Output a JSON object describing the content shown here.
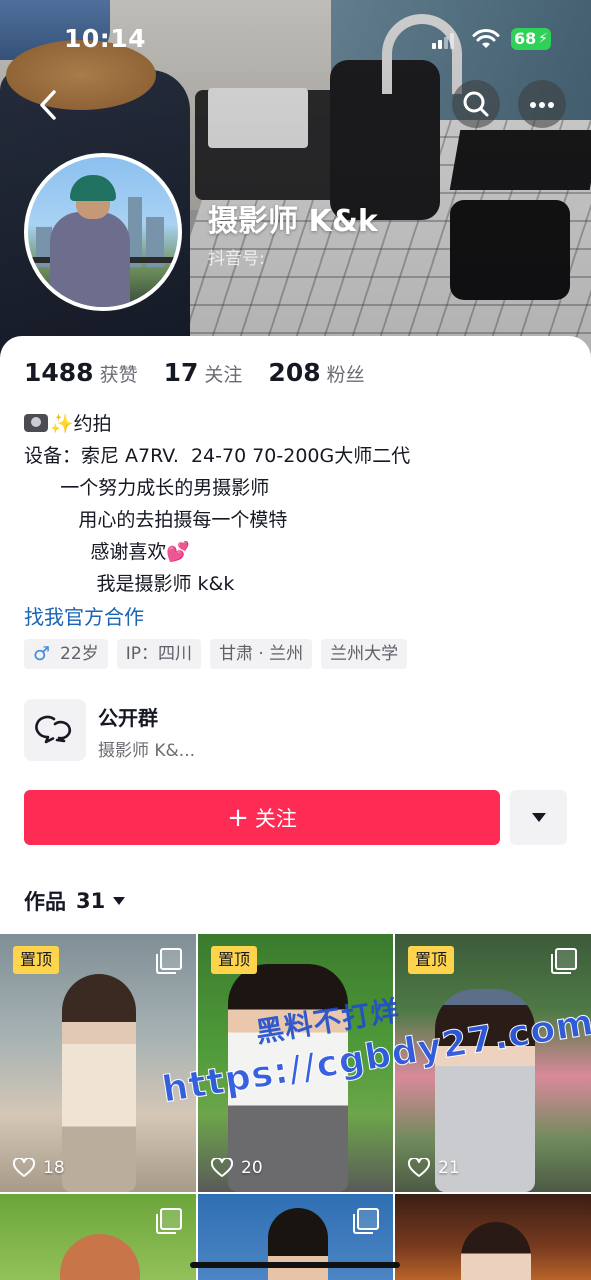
{
  "status_bar": {
    "time": "10:14",
    "battery": "68"
  },
  "profile": {
    "name": "摄影师 K&k",
    "douyin_id_label": "抖音号:",
    "stats": [
      {
        "num": "1488",
        "label": "获赞"
      },
      {
        "num": "17",
        "label": "关注"
      },
      {
        "num": "208",
        "label": "粉丝"
      }
    ],
    "bio": {
      "line1": "✨约拍",
      "line2": "设备：索尼 A7RV.  24-70 70-200G大师二代",
      "line3": "      一个努力成长的男摄影师",
      "line4": "         用心的去拍摄每一个模特",
      "line5": "           感谢喜欢💕",
      "line6": "            我是摄影师 k&k"
    },
    "coop_link": "找我官方合作",
    "tags": [
      "22岁",
      "IP：四川",
      "甘肃 · 兰州",
      "兰州大学"
    ],
    "gender_symbol": "♂"
  },
  "group": {
    "title": "公开群",
    "subtitle": "摄影师 K&..."
  },
  "actions": {
    "follow_label": "关注",
    "follow_plus": "+"
  },
  "works_tab": {
    "label": "作品",
    "count": "31"
  },
  "grid": {
    "items": [
      {
        "pinned": "置顶",
        "likes": "18"
      },
      {
        "pinned": "置顶",
        "likes": "20"
      },
      {
        "pinned": "置顶",
        "likes": "21"
      }
    ]
  },
  "watermark": {
    "line1": "黑料不打烊",
    "line2": "https://cgbdy27.com"
  },
  "colors": {
    "accent": "#fe2c55",
    "link": "#1a64b4",
    "pin": "#fdd44b"
  },
  "icons": [
    "back-icon",
    "search-icon",
    "more-icon",
    "group-chat-icon",
    "caret-down-icon",
    "heart-icon",
    "multi-image-icon",
    "male-icon"
  ]
}
